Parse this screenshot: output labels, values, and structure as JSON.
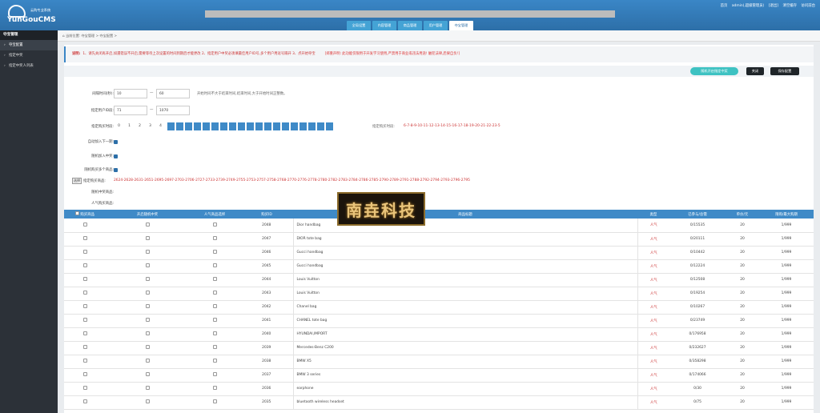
{
  "header": {
    "logo_sub": "云购专业系统",
    "logo_main": "YunGouCMS",
    "links": [
      "首页",
      "admin(,超级管理员)",
      "[退出]",
      "清空缓存",
      "访问前台"
    ]
  },
  "tabs": [
    "全局设置",
    "内容管理",
    "商品管理",
    "用户管理",
    "夺宝管理"
  ],
  "sidebar": {
    "heading": "夺宝管理",
    "items": [
      {
        "label": "夺宝配置",
        "active": true
      },
      {
        "label": "指定中奖",
        "active": false
      },
      {
        "label": "指定中奖人列表",
        "active": false
      }
    ]
  },
  "breadcrumb": "当前位置: 夺宝管理 > 夺宝配置 >",
  "notice": {
    "prefix": "说明:",
    "text": "1、请先关闭再开启,如遇错误不开启,需要等待上次设置的时间到期后才能更改  2、指定用户中奖必须填最佳用户ID号,多个用户用逗号隔开  3、点开始夺宝",
    "warning": "[郑重声明: 此功能仅限用于开发学习使用,严禁用于商业或违法用途!  触犯法律,后果自负!]"
  },
  "buttons": {
    "random": "随机开启指定中奖",
    "close": "关闭",
    "save": "保存配置"
  },
  "form": {
    "time_label": "间隔时间(秒):",
    "time_from": "10",
    "time_to": "60",
    "time_hint": "开始时间不大于结束时间,结束时间,大于开始时间正整数。",
    "user_label": "指定用户ID段:",
    "user_from": "71",
    "user_to": "1070",
    "buy_label": "指定购买时段:",
    "buy_nums": [
      "0",
      "1",
      "2",
      "3",
      "4"
    ],
    "buy_on_count": 19,
    "buy_hint_label": "指定购买时段:",
    "buy_hint_value": "6-7-8-9-10-11-12-13-14-15-16-17-18-19-20-21-22-23-5",
    "check1": "自动加入下一期:",
    "check2": "随机加入中奖:",
    "check3": "随机购买多个商品:",
    "goods_label": "指定购买商品:",
    "goods_btn": "选择",
    "goods_value": "2624-2628-2631-2651-2695-2697-2703-2706-2727-2733-2739-2749-2755-2753-2757-2758-2768-2770-2776-2778-2780-2782-2783-2784-2786-2785-2790-2789-2791-2788-2792-2794-2793-2796-2795",
    "win_label": "随机中奖商品:",
    "pop_label": "人气购买商品:"
  },
  "table": {
    "headers": [
      "购买商品",
      "开启随机中奖",
      "人气商品选择",
      "购买ID",
      "商品标题",
      "类型",
      "已参与/总需",
      "单价/元",
      "限购/最大购期"
    ],
    "rows": [
      {
        "id": "2048",
        "title": "Dior handbag",
        "type": "人气",
        "progress": "0/15535",
        "price": "20",
        "limit": "1/999"
      },
      {
        "id": "2047",
        "title": "DIOR tote bag",
        "type": "人气",
        "progress": "0/20111",
        "price": "20",
        "limit": "1/999"
      },
      {
        "id": "2046",
        "title": "Gucci handbag",
        "type": "人气",
        "progress": "0/10442",
        "price": "20",
        "limit": "1/999"
      },
      {
        "id": "2045",
        "title": "Gucci handbag",
        "type": "人气",
        "progress": "0/12224",
        "price": "20",
        "limit": "1/999"
      },
      {
        "id": "2044",
        "title": "Louis Vuitton",
        "type": "人气",
        "progress": "0/12508",
        "price": "20",
        "limit": "1/999"
      },
      {
        "id": "2043",
        "title": "Louis Vuitton",
        "type": "人气",
        "progress": "0/19254",
        "price": "20",
        "limit": "1/999"
      },
      {
        "id": "2042",
        "title": "Chanel bag",
        "type": "人气",
        "progress": "0/10267",
        "price": "20",
        "limit": "1/999"
      },
      {
        "id": "2041",
        "title": "CHANEL tote bag",
        "type": "人气",
        "progress": "0/23749",
        "price": "20",
        "limit": "1/999"
      },
      {
        "id": "2040",
        "title": "HYUNDAI,IMPORT",
        "type": "人气",
        "progress": "0/176958",
        "price": "20",
        "limit": "1/999"
      },
      {
        "id": "2039",
        "title": "Mercedes-Benz C200",
        "type": "人气",
        "progress": "0/232627",
        "price": "20",
        "limit": "1/999"
      },
      {
        "id": "2038",
        "title": "BMW X5",
        "type": "人气",
        "progress": "0/358298",
        "price": "20",
        "limit": "1/999"
      },
      {
        "id": "2037",
        "title": "BMW 3 series",
        "type": "人气",
        "progress": "0/174066",
        "price": "20",
        "limit": "1/999"
      },
      {
        "id": "2036",
        "title": "earphone",
        "type": "人气",
        "progress": "0/30",
        "price": "20",
        "limit": "1/999"
      },
      {
        "id": "2035",
        "title": "bluetooth wireless headset",
        "type": "人气",
        "progress": "0/75",
        "price": "20",
        "limit": "1/999"
      }
    ]
  },
  "watermark": "南垚科技",
  "colors": {
    "header": "#3a86c6",
    "table_head": "#3f8ac7",
    "accent_red": "#cc3333",
    "sidebar": "#2c3138"
  }
}
